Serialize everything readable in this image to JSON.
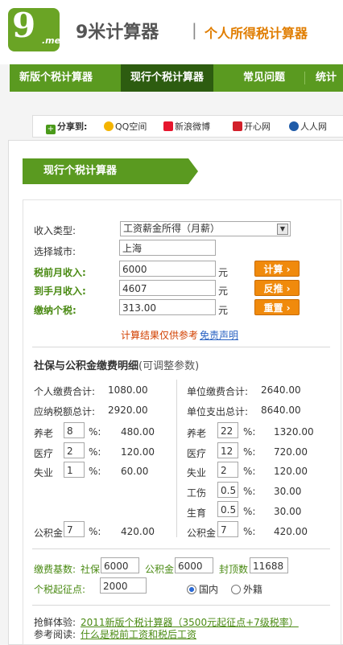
{
  "header": {
    "logo_text": "9",
    "logo_sub": ".me",
    "site_name": "9米计算器",
    "separator": "|",
    "subtitle": "个人所得税计算器"
  },
  "nav": {
    "items": [
      {
        "label": "新版个税计算器"
      },
      {
        "label": "现行个税计算器"
      },
      {
        "label": "常见问题"
      },
      {
        "label": "统计"
      }
    ]
  },
  "share": {
    "label": "分享到:",
    "items": [
      {
        "label": "QQ空间",
        "color": "#f4b400"
      },
      {
        "label": "新浪微博",
        "color": "#e6162d"
      },
      {
        "label": "开心网",
        "color": "#d2202a"
      },
      {
        "label": "人人网",
        "color": "#1f5ba8"
      }
    ]
  },
  "panel": {
    "tab_title": "现行个税计算器"
  },
  "form": {
    "income_type_label": "收入类型:",
    "income_type_value": "工资薪金所得（月薪）",
    "city_label": "选择城市:",
    "city_value": "上海",
    "pre_tax_label": "税前月收入:",
    "pre_tax_value": "6000",
    "take_home_label": "到手月收入:",
    "take_home_value": "4607",
    "tax_label": "缴纳个税:",
    "tax_value": "313.00",
    "unit": "元",
    "calc_button": "计算 ›",
    "reverse_button": "反推 ›",
    "reset_button": "重置 ›",
    "disclaimer_text": "计算结果仅供参考",
    "disclaimer_link": "免责声明"
  },
  "insurance": {
    "title": "社保与公积金缴费明细",
    "title_note": "(可调整参数)",
    "personal_total_label": "个人缴费合计:",
    "personal_total_value": "1080.00",
    "taxable_total_label": "应纳税额总计:",
    "taxable_total_value": "2920.00",
    "employer_total_label": "单位缴费合计:",
    "employer_total_value": "2640.00",
    "employer_spend_label": "单位支出总计:",
    "employer_spend_value": "8640.00",
    "percent": "%:",
    "personal_rows": [
      {
        "label": "养老",
        "rate": "8",
        "amount": "480.00"
      },
      {
        "label": "医疗",
        "rate": "2",
        "amount": "120.00"
      },
      {
        "label": "失业",
        "rate": "1",
        "amount": "60.00"
      }
    ],
    "personal_fund": {
      "label": "公积金",
      "rate": "7",
      "amount": "420.00"
    },
    "employer_rows": [
      {
        "label": "养老",
        "rate": "22",
        "amount": "1320.00"
      },
      {
        "label": "医疗",
        "rate": "12",
        "amount": "720.00"
      },
      {
        "label": "失业",
        "rate": "2",
        "amount": "120.00"
      },
      {
        "label": "工伤",
        "rate": "0.5",
        "amount": "30.00"
      },
      {
        "label": "生育",
        "rate": "0.5",
        "amount": "30.00"
      }
    ],
    "employer_fund": {
      "label": "公积金",
      "rate": "7",
      "amount": "420.00"
    }
  },
  "base": {
    "label": "缴费基数:",
    "social_label": "社保",
    "social_value": "6000",
    "fund_label": "公积金",
    "fund_value": "6000",
    "cap_label": "封顶数",
    "cap_value": "11688",
    "threshold_label": "个税起征点:",
    "threshold_value": "2000",
    "domestic_label": "国内",
    "foreign_label": "外籍"
  },
  "footer": {
    "try_label": "抢鲜体验:",
    "try_link": "2011新版个税计算器（3500元起征点+7级税率）",
    "read_label": "参考阅读:",
    "read_link": "什么是税前工资和税后工资"
  }
}
